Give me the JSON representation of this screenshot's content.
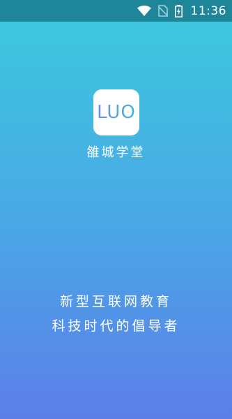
{
  "status_bar": {
    "time": "11:36",
    "icons": [
      "wifi-icon",
      "no-sim-icon",
      "battery-charging-icon"
    ]
  },
  "splash": {
    "logo_text": "LUO",
    "app_name": "雒城学堂",
    "slogan_line1": "新型互联网教育",
    "slogan_line2": "科技时代的倡导者"
  },
  "colors": {
    "status_bar": "#1f8599",
    "gradient_top": "#3bcbdd",
    "gradient_bottom": "#5c7ee8",
    "logo_text": "#4a8fe0"
  }
}
